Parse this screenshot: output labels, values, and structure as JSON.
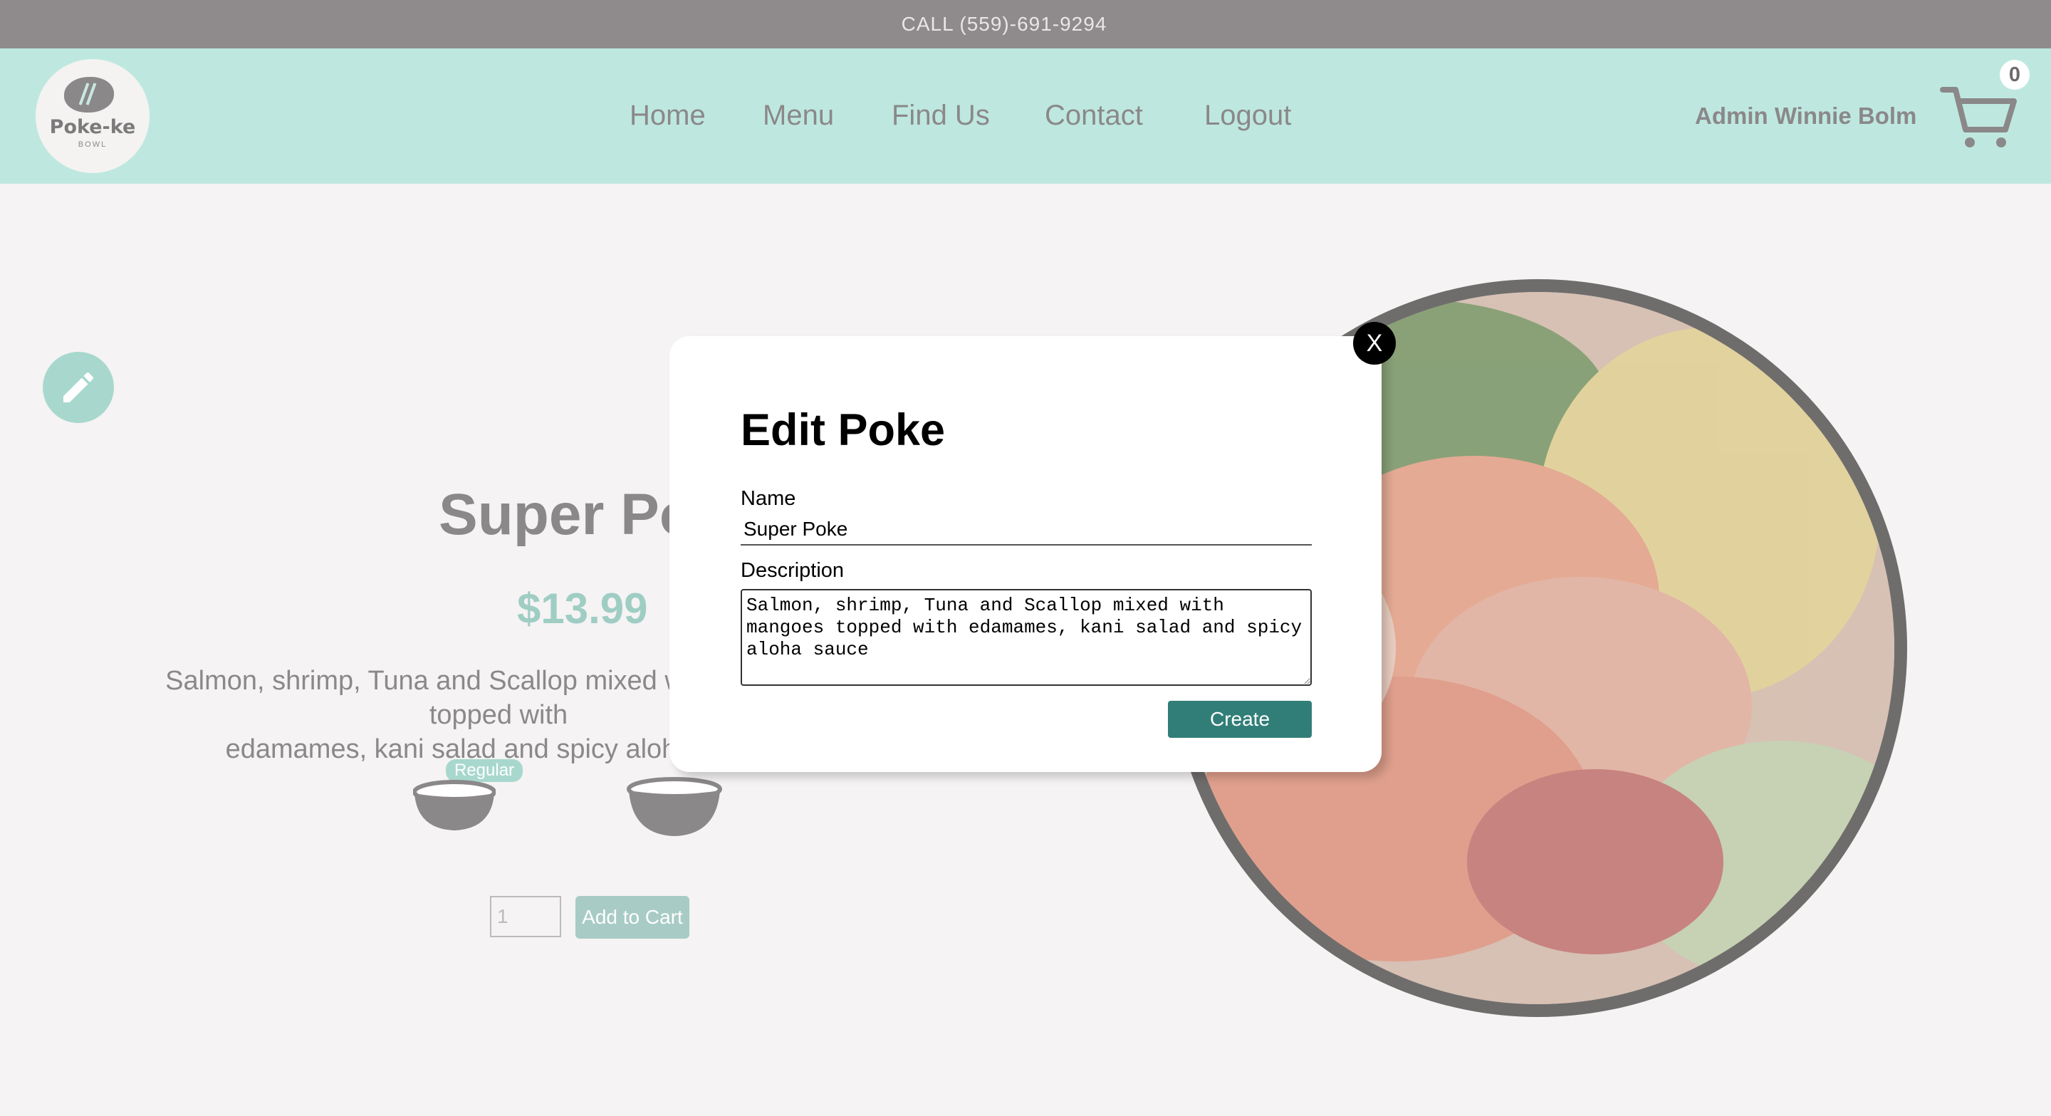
{
  "topbar": {
    "phone_text": "CALL (559)-691-9294"
  },
  "header": {
    "logo_text": "Poke-ke",
    "logo_sub": "BOWL",
    "nav": [
      {
        "label": "Home"
      },
      {
        "label": "Menu"
      },
      {
        "label": "Find Us"
      },
      {
        "label": "Contact"
      },
      {
        "label": "Logout"
      }
    ],
    "user_name": "Admin Winnie Bolm",
    "cart_count": "0",
    "cart_icon": "cart-icon"
  },
  "product": {
    "title": "Super Poke",
    "price": "$13.99",
    "description_line1": "Salmon, shrimp, Tuna and Scallop mixed with mangoes topped with",
    "description_line2": "edamames, kani salad and spicy aloha sauce",
    "sizes": [
      {
        "label": "Regular",
        "selected": true
      },
      {
        "label": "",
        "selected": false
      }
    ],
    "quantity": "1",
    "add_to_cart_label": "Add to Cart",
    "edit_icon": "pencil-icon"
  },
  "modal": {
    "title": "Edit Poke",
    "name_label": "Name",
    "name_value": "Super Poke",
    "description_label": "Description",
    "description_value": "Salmon, shrimp, Tuna and Scallop mixed with mangoes topped with edamames, kani salad and spicy aloha sauce",
    "create_label": "Create",
    "close_label": "X"
  },
  "colors": {
    "header_bg": "#bee8df",
    "topbar_bg": "#8f8b8c",
    "accent": "#317e78",
    "price": "#9fcdc4"
  }
}
